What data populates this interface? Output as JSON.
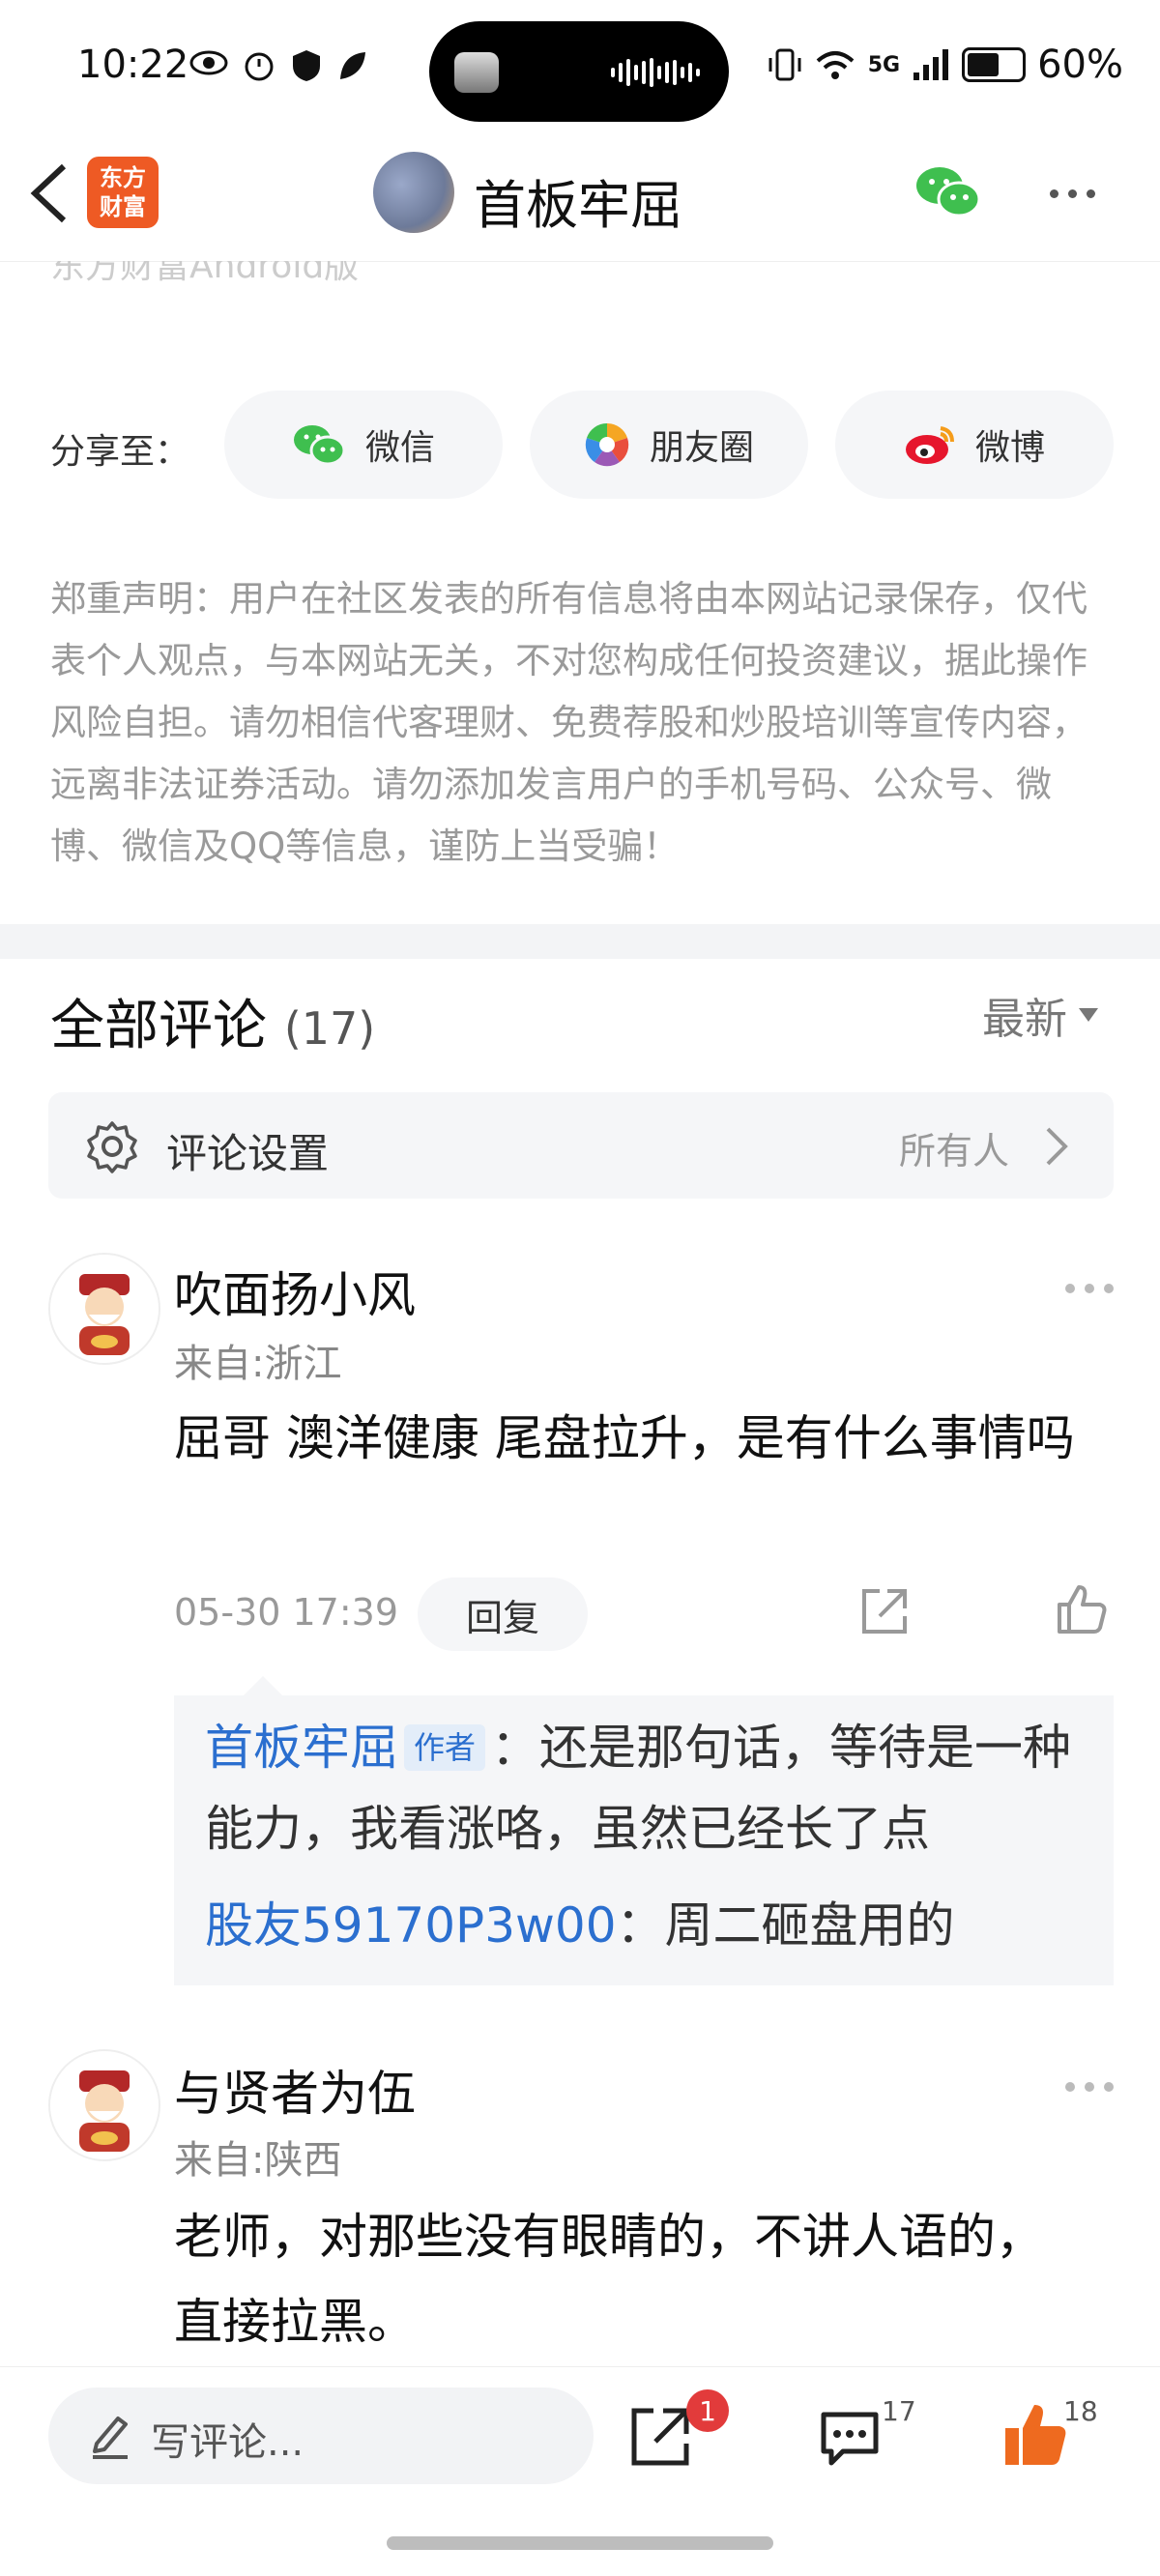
{
  "status": {
    "time": "10:22",
    "battery": "60%",
    "network": "5G"
  },
  "nav": {
    "title": "首板牢屈",
    "app_logo_line1": "东方",
    "app_logo_line2": "财富"
  },
  "source": "东方财富Android版",
  "share": {
    "label": "分享至：",
    "options": [
      "微信",
      "朋友圈",
      "微博"
    ]
  },
  "disclaimer": "郑重声明：用户在社区发表的所有信息将由本网站记录保存，仅代表个人观点，与本网站无关，不对您构成任何投资建议，据此操作风险自担。请勿相信代客理财、免费荐股和炒股培训等宣传内容，远离非法证券活动。请勿添加发言用户的手机号码、公众号、微博、微信及QQ等信息，谨防上当受骗！",
  "comments": {
    "title": "全部评论",
    "count": "(17)",
    "sort": "最新",
    "settings_label": "评论设置",
    "settings_value": "所有人",
    "items": [
      {
        "name": "吹面扬小风",
        "location": "来自:浙江",
        "text": "屈哥  澳洋健康 尾盘拉升，是有什么事情吗",
        "time": "05-30 17:39",
        "reply_label": "回复",
        "replies": [
          {
            "user": "首板牢屈",
            "badge": "作者",
            "text": "：还是那句话，等待是一种能力，我看涨咯，虽然已经长了点"
          },
          {
            "user": "股友59170P3w00",
            "text": "：周二砸盘用的"
          }
        ]
      },
      {
        "name": "与贤者为伍",
        "location": "来自:陕西",
        "text": "老师，对那些没有眼睛的，不讲人语的，直接拉黑。"
      }
    ]
  },
  "bottom": {
    "write_placeholder": "写评论...",
    "share_badge": "1",
    "comment_count": "17",
    "like_count": "18"
  },
  "colors": {
    "accent_blue": "#2b6fcf",
    "like_orange": "#ee6a1f",
    "wechat_green": "#3fbf4f",
    "badge_red": "#e23b3b"
  }
}
